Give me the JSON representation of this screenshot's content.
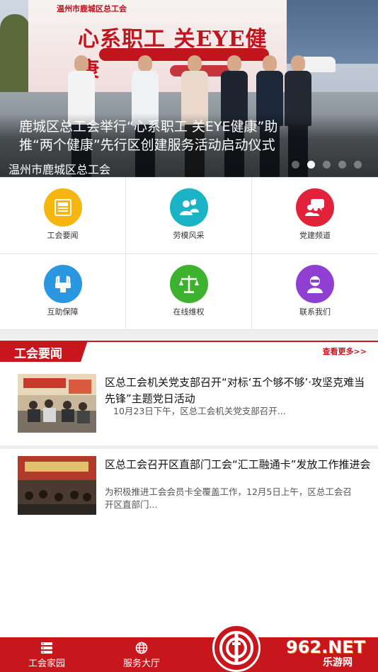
{
  "banner": {
    "caption": "鹿城区总工会举行“心系职工 关EYE健康”助推“两个健康”先行区创建服务活动启动仪式",
    "source": "温州市鹿城区总工会",
    "dots_total": 5,
    "active_dot": 2,
    "backdrop_brand": "温州市鹿城区总工会",
    "backdrop_slogan": "心系职工 关EYE健康"
  },
  "grid": {
    "items": [
      {
        "label": "工会要闻",
        "icon": "newspaper-icon",
        "color": "#f5b60f"
      },
      {
        "label": "劳模风采",
        "icon": "model-worker-icon",
        "color": "#1ab4c6"
      },
      {
        "label": "党建频道",
        "icon": "party-chat-icon",
        "color": "#e2213a"
      },
      {
        "label": "互助保障",
        "icon": "mutual-aid-icon",
        "color": "#2a97e0"
      },
      {
        "label": "在线维权",
        "icon": "scales-icon",
        "color": "#3db22f"
      },
      {
        "label": "联系我们",
        "icon": "contact-icon",
        "color": "#8f3fd1"
      }
    ]
  },
  "section": {
    "title": "工会要闻",
    "more": "查看更多>>"
  },
  "news": [
    {
      "title": "区总工会机关党支部召开“对标‘五个够不够’·攻坚克难当先锋”主题党日活动",
      "desc": "10月23日下午，区总工会机关党支部召开..."
    },
    {
      "title": "区总工会召开区直部门工会“汇工融通卡”发放工作推进会",
      "desc": "为积极推进工会会员卡全覆盖工作，12月5日上午，区总工会召开区直部门..."
    }
  ],
  "tabbar": {
    "home": "工会家园",
    "service": "服务大厅",
    "watermark_brand": "962.NET",
    "watermark_sub": "乐游网"
  },
  "colors": {
    "brand_red": "#c8161d"
  }
}
